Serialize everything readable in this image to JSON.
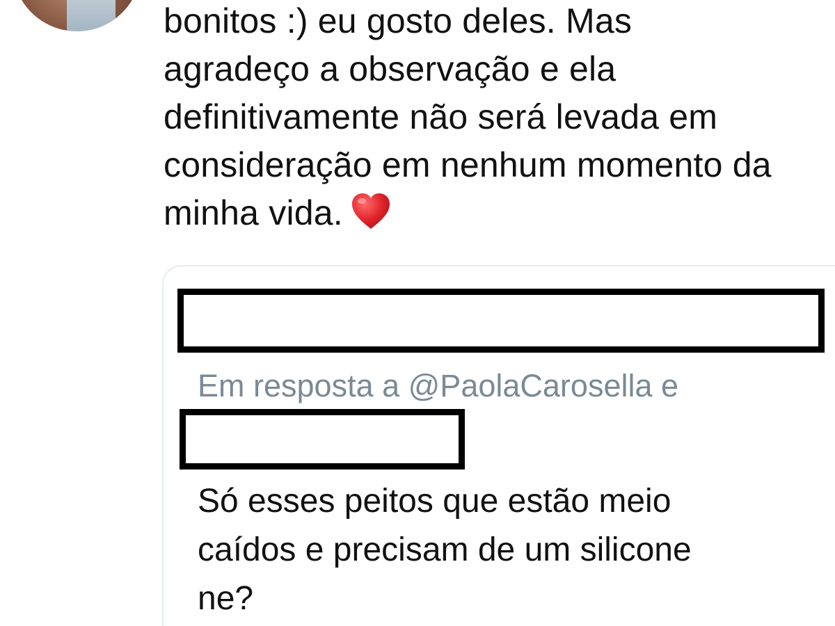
{
  "tweet": {
    "lines": [
      "bonitos :) eu gosto deles.  Mas",
      "agradeço a observação e ela",
      "definitivamente não será levada em",
      "consideração em nenhum momento da",
      "minha vida."
    ],
    "end_emoji": "heart-icon",
    "emoji_color": "#e0242b"
  },
  "quoted_tweet": {
    "reply_to": "Em resposta a @PaolaCarosella e",
    "lines": [
      "Só esses peitos que estão meio",
      "caídos e precisam de um silicone",
      "ne?"
    ]
  }
}
